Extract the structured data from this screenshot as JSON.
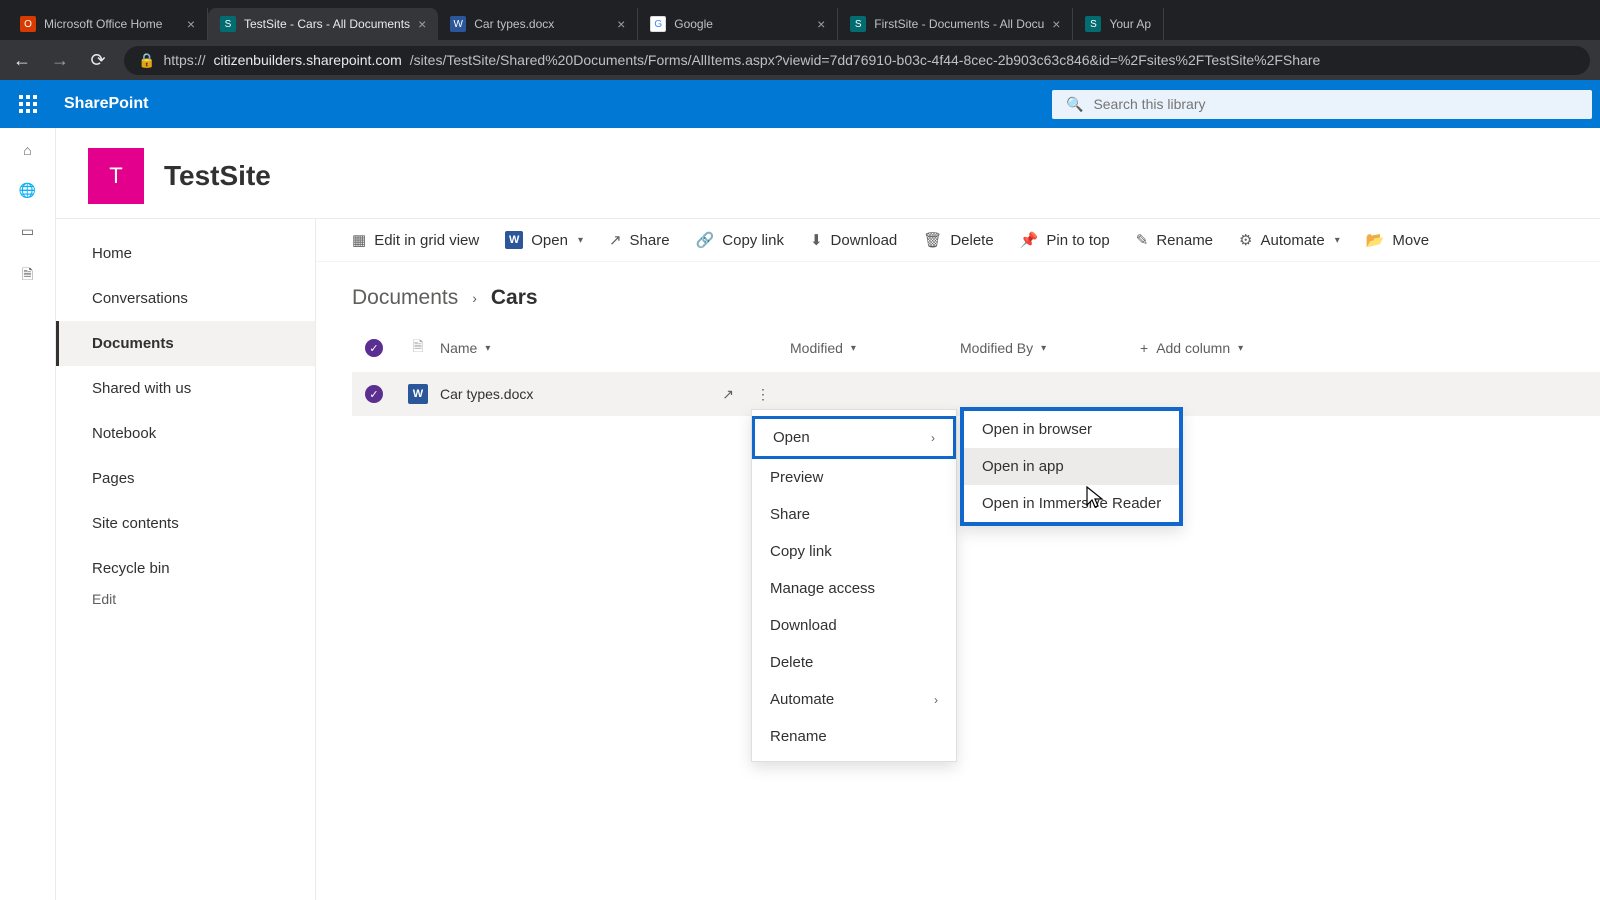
{
  "browser": {
    "tabs": [
      {
        "title": "Microsoft Office Home",
        "favicon_bg": "#d83b01",
        "favicon_letter": "O",
        "active": false
      },
      {
        "title": "TestSite - Cars - All Documents",
        "favicon_bg": "#036c70",
        "favicon_letter": "S",
        "active": true
      },
      {
        "title": "Car types.docx",
        "favicon_bg": "#2b579a",
        "favicon_letter": "W",
        "active": false
      },
      {
        "title": "Google",
        "favicon_bg": "#ffffff",
        "favicon_letter": "G",
        "active": false
      },
      {
        "title": "FirstSite - Documents - All Docu",
        "favicon_bg": "#036c70",
        "favicon_letter": "S",
        "active": false
      },
      {
        "title": "Your Ap",
        "favicon_bg": "#036c70",
        "favicon_letter": "S",
        "active": false
      }
    ],
    "url_prefix": "https://",
    "url_host": "citizenbuilders.sharepoint.com",
    "url_path": "/sites/TestSite/Shared%20Documents/Forms/AllItems.aspx?viewid=7dd76910-b03c-4f44-8cec-2b903c63c846&id=%2Fsites%2FTestSite%2FShare"
  },
  "suite": {
    "brand": "SharePoint",
    "search_placeholder": "Search this library"
  },
  "site": {
    "logo_letter": "T",
    "title": "TestSite",
    "nav": [
      {
        "label": "Home",
        "selected": false
      },
      {
        "label": "Conversations",
        "selected": false
      },
      {
        "label": "Documents",
        "selected": true
      },
      {
        "label": "Shared with us",
        "selected": false
      },
      {
        "label": "Notebook",
        "selected": false
      },
      {
        "label": "Pages",
        "selected": false
      },
      {
        "label": "Site contents",
        "selected": false
      },
      {
        "label": "Recycle bin",
        "selected": false
      }
    ],
    "nav_edit": "Edit"
  },
  "commands": {
    "edit_grid": "Edit in grid view",
    "open": "Open",
    "share": "Share",
    "copy_link": "Copy link",
    "download": "Download",
    "delete": "Delete",
    "pin": "Pin to top",
    "rename": "Rename",
    "automate": "Automate",
    "move": "Move"
  },
  "breadcrumb": {
    "root": "Documents",
    "current": "Cars"
  },
  "columns": {
    "name": "Name",
    "modified": "Modified",
    "modified_by": "Modified By",
    "add": "Add column"
  },
  "files": [
    {
      "name": "Car types.docx"
    }
  ],
  "ctx": {
    "open": "Open",
    "preview": "Preview",
    "share": "Share",
    "copy_link": "Copy link",
    "manage_access": "Manage access",
    "download": "Download",
    "delete": "Delete",
    "automate": "Automate",
    "rename": "Rename"
  },
  "submenu": {
    "browser": "Open in browser",
    "app": "Open in app",
    "immersive": "Open in Immersive Reader"
  }
}
